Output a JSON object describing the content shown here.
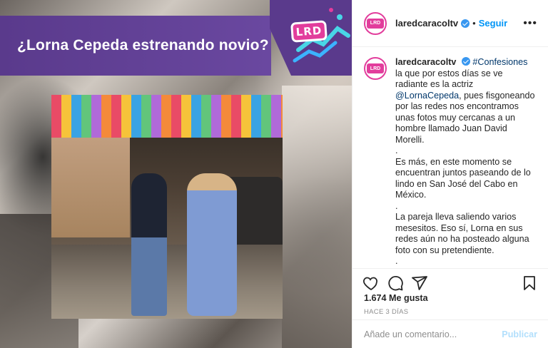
{
  "media": {
    "banner_title": "¿Lorna Cepeda estrenando novio?",
    "badge_text": "LRD",
    "colors": {
      "banner": "#5a3a8c",
      "badge": "#e23d9c"
    }
  },
  "post": {
    "username": "laredcaracoltv",
    "follow_label": "Seguir",
    "dot_separator": "•",
    "more_label": "•••",
    "avatar_text": "LRD",
    "caption": {
      "username": "laredcaracoltv",
      "hashtag": "#Confesiones",
      "para1_before": "la que por estos días se ve radiante es la actriz ",
      "mention": "@LornaCepeda",
      "para1_after": ", pues fisgoneando por las redes nos encontramos unas fotos muy cercanas a un hombre llamado Juan David Morelli.",
      "dot_line": ".",
      "para2": "Es más, en este momento se encuentran juntos paseando de lo lindo en San José del Cabo en México.",
      "para3": "La pareja lleva saliendo varios mesesitos. Eso sí, Lorna en sus redes aún no ha posteado alguna foto con su pretendiente."
    },
    "icons": [
      "heart-icon",
      "comment-icon",
      "share-icon",
      "bookmark-icon"
    ],
    "likes": "1.674 Me gusta",
    "timestamp": "HACE 3 DÍAS",
    "comment_placeholder": "Añade un comentario...",
    "publish_label": "Publicar"
  }
}
